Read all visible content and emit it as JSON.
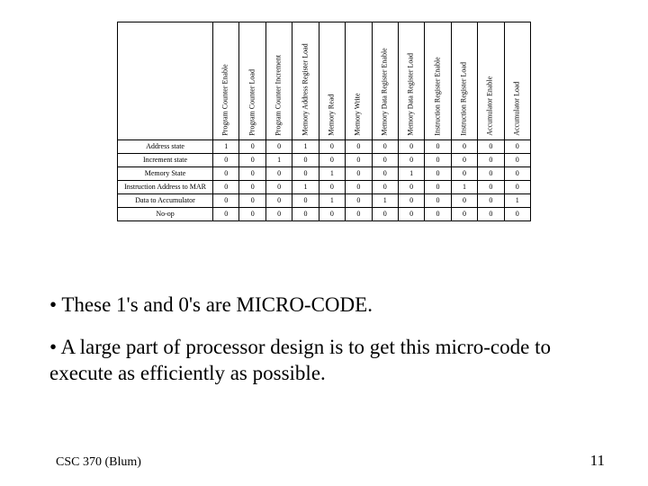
{
  "chart_data": {
    "type": "table",
    "columns": [
      "Program Counter Enable",
      "Program Counter Load",
      "Program Counter Increment",
      "Memory Address Register Load",
      "Memory Read",
      "Memory Write",
      "Memory Data Register Enable",
      "Memory Data Register Load",
      "Instruction Register Enable",
      "Instruction Register Load",
      "Accumulator Enable",
      "Accumulator Load"
    ],
    "rows": [
      {
        "label": "Address state",
        "values": [
          1,
          0,
          0,
          1,
          0,
          0,
          0,
          0,
          0,
          0,
          0,
          0
        ]
      },
      {
        "label": "Increment state",
        "values": [
          0,
          0,
          1,
          0,
          0,
          0,
          0,
          0,
          0,
          0,
          0,
          0
        ]
      },
      {
        "label": "Memory State",
        "values": [
          0,
          0,
          0,
          0,
          1,
          0,
          0,
          1,
          0,
          0,
          0,
          0
        ]
      },
      {
        "label": "Instruction Address to MAR",
        "values": [
          0,
          0,
          0,
          1,
          0,
          0,
          0,
          0,
          0,
          1,
          0,
          0
        ]
      },
      {
        "label": "Data to Accumulator",
        "values": [
          0,
          0,
          0,
          0,
          1,
          0,
          1,
          0,
          0,
          0,
          0,
          1
        ]
      },
      {
        "label": "No-op",
        "values": [
          0,
          0,
          0,
          0,
          0,
          0,
          0,
          0,
          0,
          0,
          0,
          0
        ]
      }
    ]
  },
  "bullets": {
    "b1": "• These 1's and 0's are MICRO-CODE.",
    "b2": "• A large part of processor design is to get this micro-code to execute as efficiently as possible."
  },
  "footer": {
    "left": "CSC 370 (Blum)",
    "right": "11"
  }
}
